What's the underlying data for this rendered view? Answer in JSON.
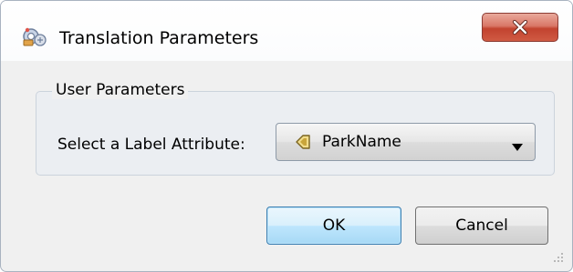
{
  "window": {
    "title": "Translation Parameters",
    "app_icon": "fme-workbench-icon",
    "close_icon": "close-x-icon"
  },
  "group": {
    "legend": "User Parameters"
  },
  "field": {
    "label": "Select a Label Attribute:",
    "selected_value": "ParkName",
    "value_icon": "attribute-tag-icon",
    "dropdown_icon": "chevron-down-icon"
  },
  "buttons": {
    "ok_label": "OK",
    "cancel_label": "Cancel"
  },
  "colors": {
    "dialog_bg": "#f0f0f0",
    "close_button": "#c2432f",
    "ok_border": "#3c7fb1"
  }
}
